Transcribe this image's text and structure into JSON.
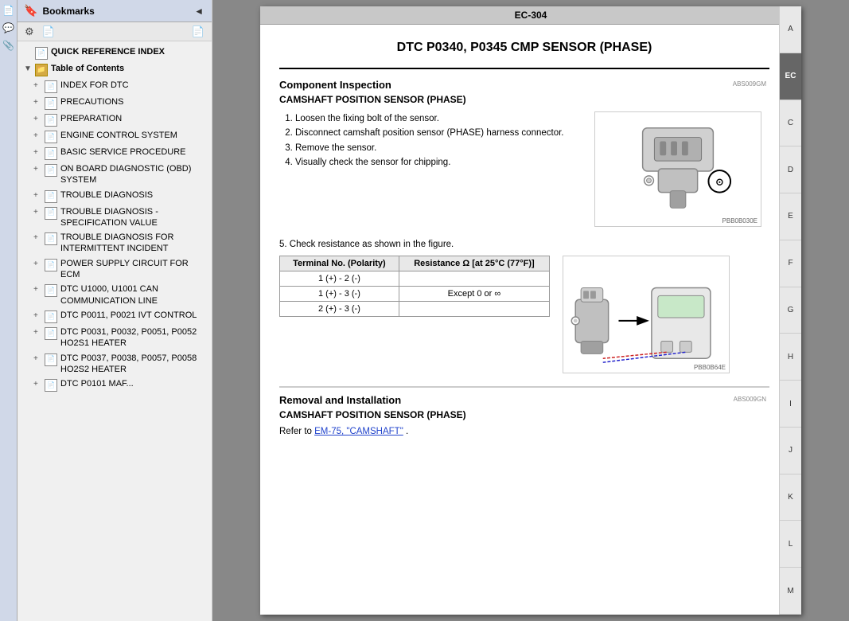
{
  "leftPanel": {
    "bookmarksTitle": "Bookmarks",
    "collapseBtn": "◄",
    "toolbarIcons": [
      "⚙",
      "📄"
    ],
    "tree": [
      {
        "id": "quick-ref",
        "label": "QUICK REFERENCE INDEX",
        "indent": 0,
        "icon": "page",
        "expand": ""
      },
      {
        "id": "toc",
        "label": "Table of Contents",
        "indent": 0,
        "icon": "folder",
        "expand": "▼",
        "expanded": true
      },
      {
        "id": "index-dtc",
        "label": "INDEX FOR DTC",
        "indent": 1,
        "icon": "page",
        "expand": "+"
      },
      {
        "id": "precautions",
        "label": "PRECAUTIONS",
        "indent": 1,
        "icon": "page",
        "expand": "+"
      },
      {
        "id": "preparation",
        "label": "PREPARATION",
        "indent": 1,
        "icon": "page",
        "expand": "+"
      },
      {
        "id": "engine-ctrl",
        "label": "ENGINE CONTROL SYSTEM",
        "indent": 1,
        "icon": "page",
        "expand": "+"
      },
      {
        "id": "basic-svc",
        "label": "BASIC SERVICE PROCEDURE",
        "indent": 1,
        "icon": "page",
        "expand": "+"
      },
      {
        "id": "obd",
        "label": "ON BOARD DIAGNOSTIC (OBD) SYSTEM",
        "indent": 1,
        "icon": "page",
        "expand": "+"
      },
      {
        "id": "trouble-diag",
        "label": "TROUBLE DIAGNOSIS",
        "indent": 1,
        "icon": "page",
        "expand": "+"
      },
      {
        "id": "trouble-spec",
        "label": "TROUBLE DIAGNOSIS - SPECIFICATION VALUE",
        "indent": 1,
        "icon": "page",
        "expand": "+"
      },
      {
        "id": "trouble-inter",
        "label": "TROUBLE DIAGNOSIS FOR INTERMITTENT INCIDENT",
        "indent": 1,
        "icon": "page",
        "expand": "+"
      },
      {
        "id": "power-supply",
        "label": "POWER SUPPLY CIRCUIT FOR ECM",
        "indent": 1,
        "icon": "page",
        "expand": "+"
      },
      {
        "id": "dtc-u1000",
        "label": "DTC U1000, U1001 CAN COMMUNICATION LINE",
        "indent": 1,
        "icon": "page",
        "expand": "+"
      },
      {
        "id": "dtc-p0011",
        "label": "DTC P0011, P0021 IVT CONTROL",
        "indent": 1,
        "icon": "page",
        "expand": "+"
      },
      {
        "id": "dtc-p0031",
        "label": "DTC P0031, P0032, P0051, P0052 HO2S1 HEATER",
        "indent": 1,
        "icon": "page",
        "expand": "+"
      },
      {
        "id": "dtc-p0037",
        "label": "DTC P0037, P0038, P0057, P0058 HO2S2 HEATER",
        "indent": 1,
        "icon": "page",
        "expand": "+"
      },
      {
        "id": "dtc-p0101",
        "label": "DTC P0101 MAF...",
        "indent": 1,
        "icon": "page",
        "expand": "+"
      }
    ]
  },
  "sideIcons": [
    "📄",
    "💬",
    "📎"
  ],
  "document": {
    "pageId": "EC-304",
    "title": "DTC P0340, P0345 CMP SENSOR (PHASE)",
    "absLabel1": "ABS009GM",
    "absLabel2": "ABS009GN",
    "imgLabel1": "PBB0B030E",
    "imgLabel2": "PBB0B64E",
    "section1Title": "Component Inspection",
    "section1Subtitle": "CAMSHAFT POSITION SENSOR (PHASE)",
    "steps": [
      "Loosen the fixing bolt of the sensor.",
      "Disconnect camshaft position sensor (PHASE) harness connector.",
      "Remove the sensor.",
      "Visually check the sensor for chipping."
    ],
    "step5": "5.   Check resistance as shown in the figure.",
    "tableHeaders": [
      "Terminal No. (Polarity)",
      "Resistance Ω [at 25°C (77°F)]"
    ],
    "tableRows": [
      [
        "1 (+) - 2 (-)",
        ""
      ],
      [
        "1 (+) - 3 (-)",
        "Except 0 or ∞"
      ],
      [
        "2 (+) - 3 (-)",
        ""
      ]
    ],
    "section2Title": "Removal and Installation",
    "section2Subtitle": "CAMSHAFT POSITION SENSOR (PHASE)",
    "referText": "Refer to ",
    "referLink": "EM-75, \"CAMSHAFT\"",
    "referEnd": " ."
  },
  "alphaSidebar": {
    "items": [
      "A",
      "C",
      "D",
      "E",
      "F",
      "G",
      "H",
      "I",
      "J",
      "K",
      "L",
      "M"
    ],
    "active": "EC"
  }
}
